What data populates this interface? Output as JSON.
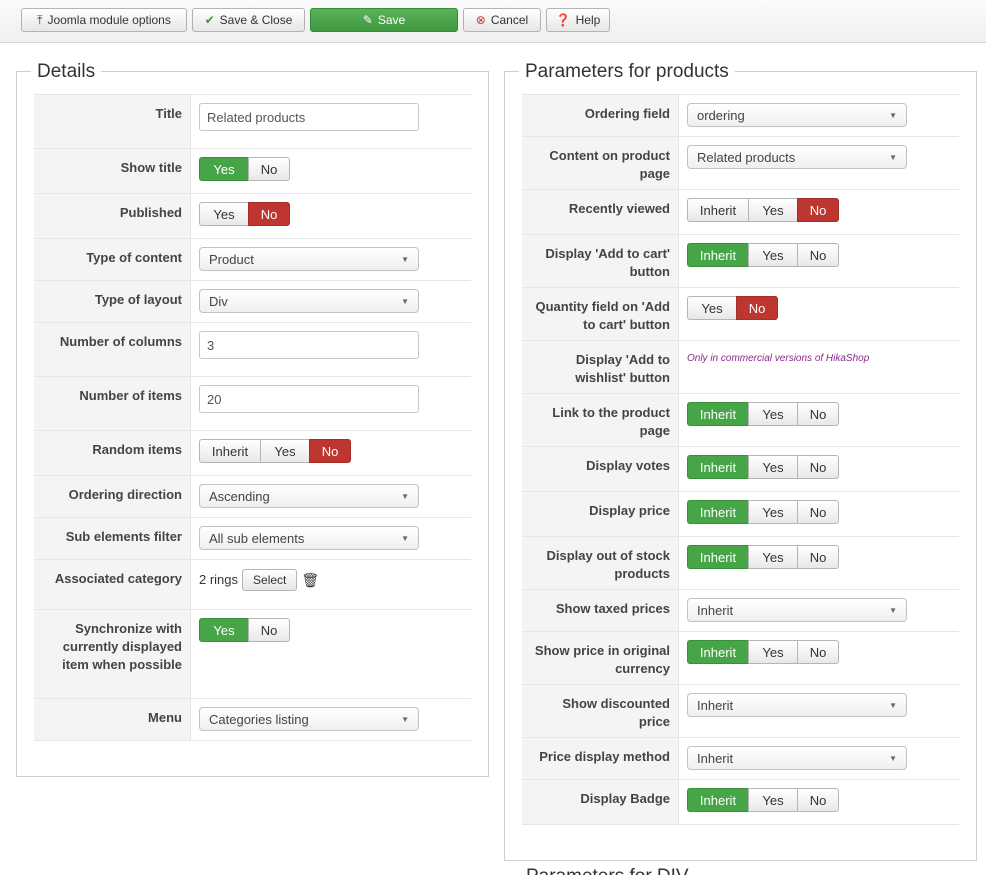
{
  "toolbar": {
    "options_label": "Joomla module options",
    "save_close_label": "Save & Close",
    "save_label": "Save",
    "cancel_label": "Cancel",
    "help_label": "Help"
  },
  "details": {
    "legend": "Details",
    "title_label": "Title",
    "title_value": "Related products",
    "show_title_label": "Show title",
    "published_label": "Published",
    "type_content_label": "Type of content",
    "type_content_value": "Product",
    "type_layout_label": "Type of layout",
    "type_layout_value": "Div",
    "num_columns_label": "Number of columns",
    "num_columns_value": "3",
    "num_items_label": "Number of items",
    "num_items_value": "20",
    "random_label": "Random items",
    "ordering_dir_label": "Ordering direction",
    "ordering_dir_value": "Ascending",
    "sub_filter_label": "Sub elements filter",
    "sub_filter_value": "All sub elements",
    "assoc_cat_label": "Associated category",
    "assoc_cat_value": "2 rings",
    "select_label": "Select",
    "sync_label": "Synchronize with currently displayed item when possible",
    "menu_label": "Menu",
    "menu_value": "Categories listing"
  },
  "params": {
    "legend": "Parameters for products",
    "ordering_field_label": "Ordering field",
    "ordering_field_value": "ordering",
    "content_page_label": "Content on product page",
    "content_page_value": "Related products",
    "recently_viewed_label": "Recently viewed",
    "add_cart_label": "Display 'Add to cart' button",
    "qty_label": "Quantity field on 'Add to cart' button",
    "wishlist_label": "Display 'Add to wishlist' button",
    "wishlist_note": "Only in commercial versions of HikaShop",
    "link_label": "Link to the product page",
    "votes_label": "Display votes",
    "price_label": "Display price",
    "out_stock_label": "Display out of stock products",
    "taxed_label": "Show taxed prices",
    "taxed_value": "Inherit",
    "orig_currency_label": "Show price in original currency",
    "discounted_label": "Show discounted price",
    "discounted_value": "Inherit",
    "price_method_label": "Price display method",
    "price_method_value": "Inherit",
    "badge_label": "Display Badge"
  },
  "opts": {
    "yes": "Yes",
    "no": "No",
    "inherit": "Inherit"
  },
  "next_legend": "Parameters for DIV",
  "colors": {
    "green": "#46a546",
    "red": "#bd362f"
  }
}
